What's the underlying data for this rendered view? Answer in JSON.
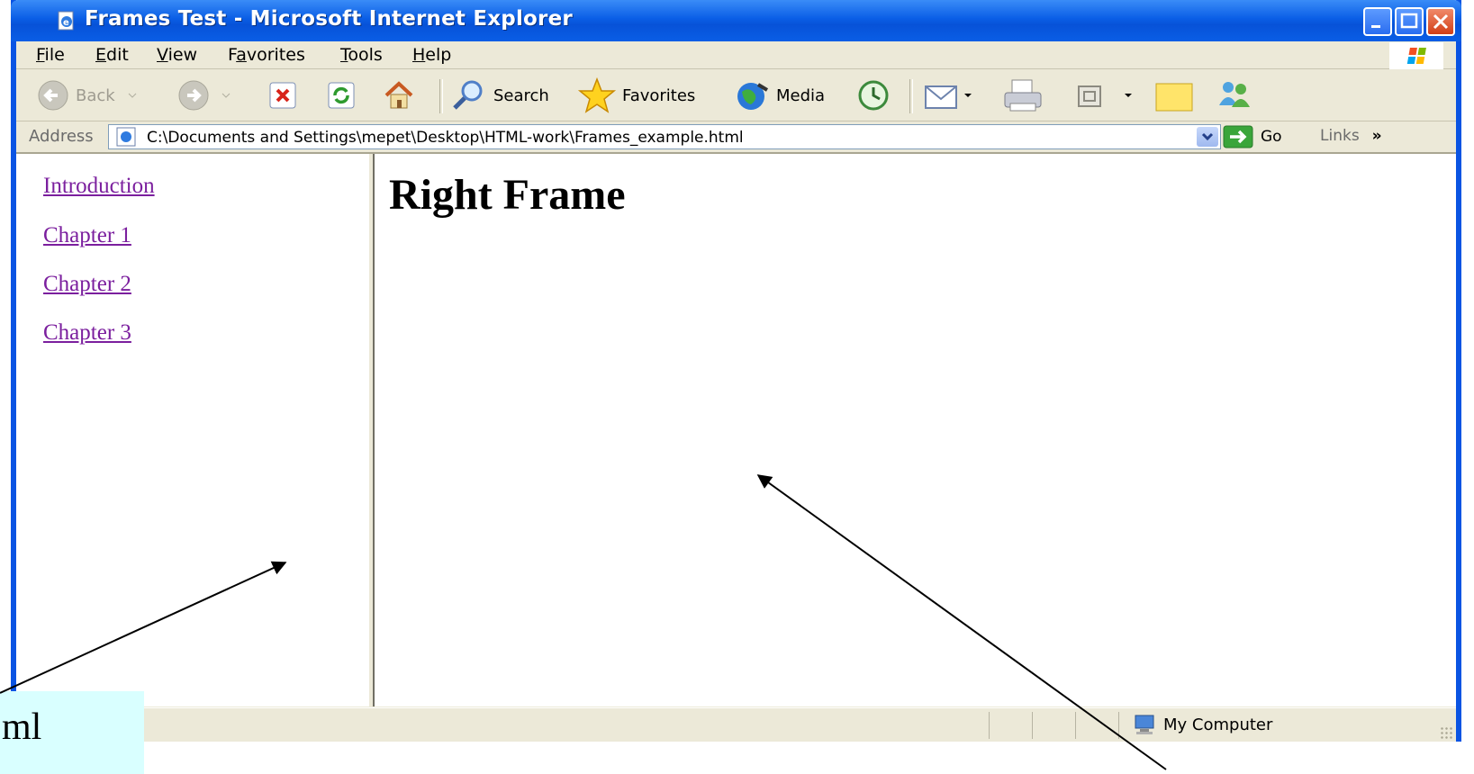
{
  "window": {
    "title": "Frames Test - Microsoft Internet Explorer",
    "title_color": "#0a5ee6"
  },
  "menubar": {
    "items": [
      {
        "label": "File",
        "mnemonic": "F"
      },
      {
        "label": "Edit",
        "mnemonic": "E"
      },
      {
        "label": "View",
        "mnemonic": "V"
      },
      {
        "label": "Favorites",
        "mnemonic": "a"
      },
      {
        "label": "Tools",
        "mnemonic": "T"
      },
      {
        "label": "Help",
        "mnemonic": "H"
      }
    ]
  },
  "toolbar": {
    "back_label": "Back",
    "search_label": "Search",
    "favorites_label": "Favorites",
    "media_label": "Media"
  },
  "address": {
    "label": "Address",
    "value": "C:\\Documents and Settings\\mepet\\Desktop\\HTML-work\\Frames_example.html",
    "go_label": "Go",
    "links_label": "Links",
    "links_chevron": "»"
  },
  "left_frame": {
    "links": [
      "Introduction",
      "Chapter 1",
      "Chapter 2",
      "Chapter 3"
    ],
    "link_color": "#7b1f9e"
  },
  "right_frame": {
    "heading": "Right Frame"
  },
  "statusbar": {
    "zone_label": "My Computer"
  },
  "annotation": {
    "callout_text": "ml",
    "callout_bg": "#d9ffff"
  }
}
